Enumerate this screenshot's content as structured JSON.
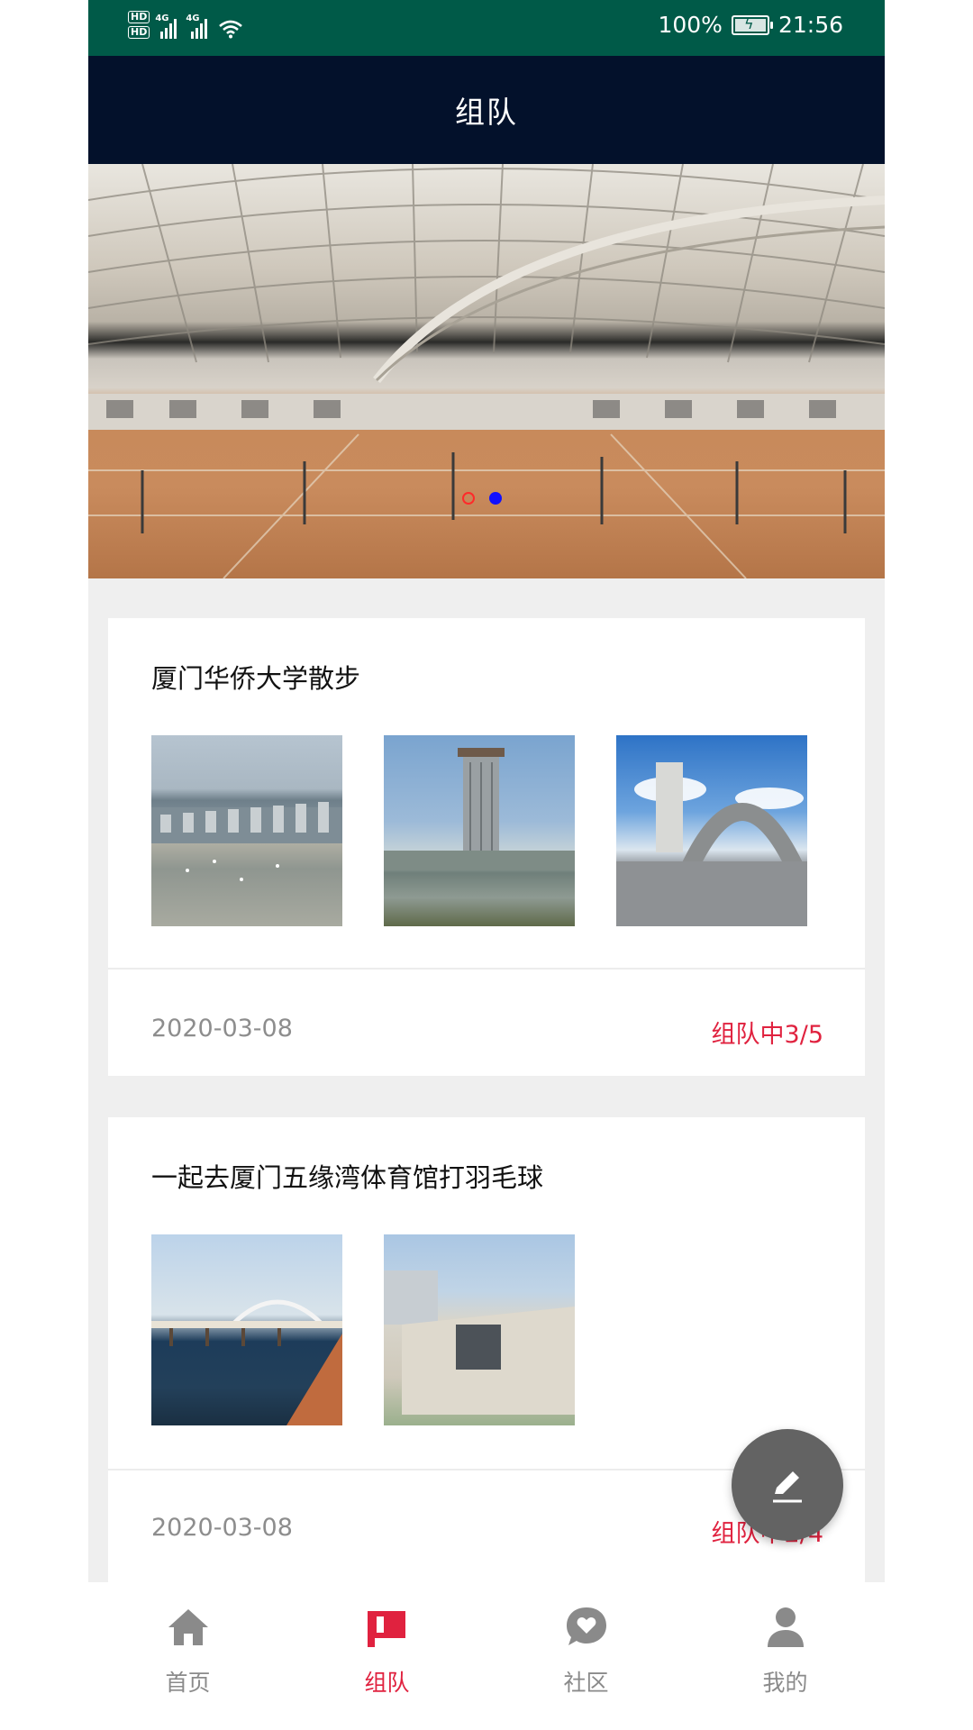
{
  "status_bar": {
    "network_badges": [
      "HD",
      "HD"
    ],
    "signal_1": "4G",
    "signal_2": "4G",
    "battery": "100%",
    "time": "21:56"
  },
  "header": {
    "title": "组队"
  },
  "banner": {
    "slide_count": 2,
    "active_index": 1,
    "indicator_colors": {
      "active": "#1010ff",
      "inactive": "#ff2a2a"
    }
  },
  "posts": [
    {
      "title": "厦门华侨大学散步",
      "images": [
        "campus-lake-buildings",
        "campus-tower",
        "campus-arch-gate"
      ],
      "date": "2020-03-08",
      "status": "组队中3/5"
    },
    {
      "title": "一起去厦门五缘湾体育馆打羽毛球",
      "images": [
        "bridge-over-water",
        "gymnasium-building"
      ],
      "date": "2020-03-08",
      "status": "组队中2/4"
    }
  ],
  "fab": {
    "icon": "edit-pencil-icon"
  },
  "tabs": [
    {
      "label": "首页",
      "icon": "home-icon",
      "active": false
    },
    {
      "label": "组队",
      "icon": "team-flag-icon",
      "active": true
    },
    {
      "label": "社区",
      "icon": "community-heart-icon",
      "active": false
    },
    {
      "label": "我的",
      "icon": "profile-icon",
      "active": false
    }
  ],
  "colors": {
    "status_bar": "#005a48",
    "app_bar": "#03112b",
    "accent": "#e0223f",
    "page_background": "#efefef"
  }
}
